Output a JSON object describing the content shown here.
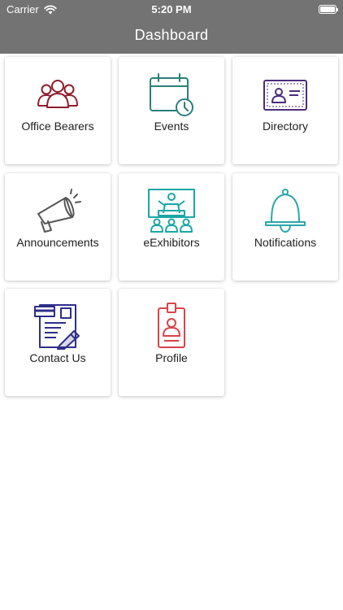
{
  "status_bar": {
    "carrier": "Carrier",
    "time": "5:20 PM",
    "battery_level": 1.0
  },
  "header": {
    "title": "Dashboard",
    "background": "#737373"
  },
  "tiles": [
    {
      "label": "Office Bearers",
      "icon": "group-icon",
      "color": "#8f1d2c"
    },
    {
      "label": "Events",
      "icon": "calendar-clock-icon",
      "color": "#2a7f7a"
    },
    {
      "label": "Directory",
      "icon": "id-card-icon",
      "color": "#4b2d7f"
    },
    {
      "label": "Announcements",
      "icon": "megaphone-icon",
      "color": "#555555"
    },
    {
      "label": "eExhibitors",
      "icon": "presentation-icon",
      "color": "#1aa6a6"
    },
    {
      "label": "Notifications",
      "icon": "bell-icon",
      "color": "#2aa7a7"
    },
    {
      "label": "Contact Us",
      "icon": "contact-form-icon",
      "color": "#2e2f8a"
    },
    {
      "label": "Profile",
      "icon": "id-badge-icon",
      "color": "#d9434a"
    }
  ]
}
